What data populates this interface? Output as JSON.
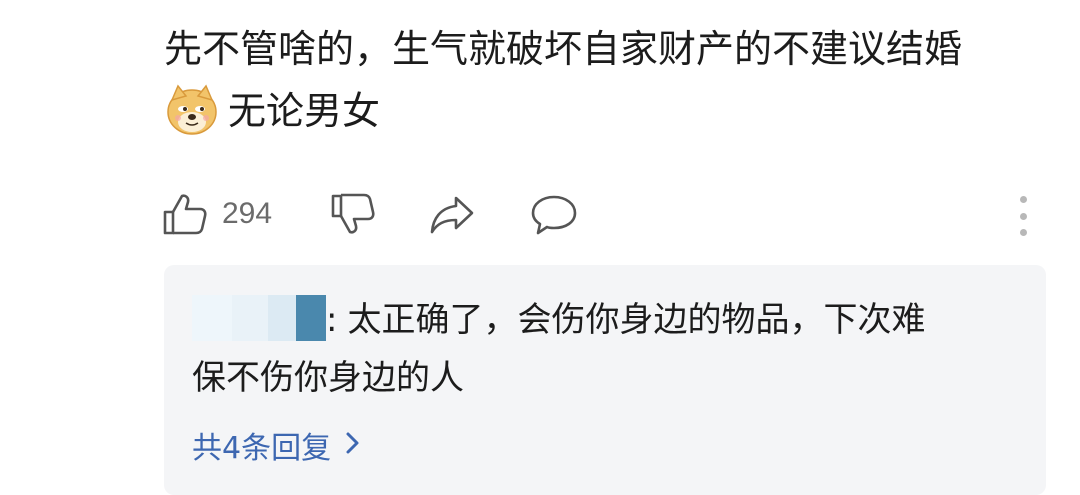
{
  "comment": {
    "line1": "先不管啥的，生气就破坏自家财产的不建议结婚",
    "line2": "无论男女",
    "emoji": "doge-emoji"
  },
  "actions": {
    "like_count": "294",
    "like_icon": "thumbs-up-icon",
    "dislike_icon": "thumbs-down-icon",
    "share_icon": "share-icon",
    "reply_icon": "comment-bubble-icon",
    "more_icon": "more-vertical-icon"
  },
  "reply": {
    "separator": ":",
    "text_line1": "太正确了，会伤你身边的物品，下次难",
    "text_line2": "保不伤你身边的人",
    "footer_label": "共4条回复",
    "footer_icon": "chevron-right-icon"
  },
  "colors": {
    "reply_bg": "#f4f5f7",
    "link": "#3d67b1",
    "icon": "#6b6b6b",
    "text": "#1c1c1c"
  }
}
